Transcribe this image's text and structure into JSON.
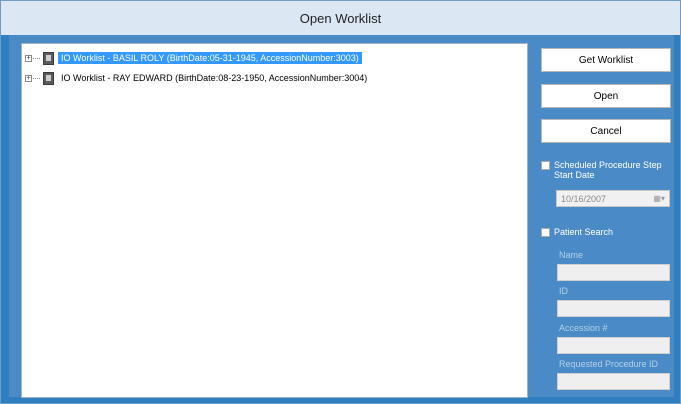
{
  "window": {
    "title": "Open Worklist"
  },
  "tree": {
    "items": [
      {
        "label": "IO Worklist - BASIL ROLY (BirthDate:05-31-1945, AccessionNumber:3003)",
        "selected": true
      },
      {
        "label": "IO Worklist - RAY EDWARD (BirthDate:08-23-1950, AccessionNumber:3004)",
        "selected": false
      }
    ]
  },
  "buttons": {
    "get_worklist": "Get Worklist",
    "open": "Open",
    "cancel": "Cancel"
  },
  "scheduled": {
    "checkbox_label": "Scheduled Procedure Step Start Date",
    "checked": false,
    "date_value": "10/16/2007"
  },
  "patient_search": {
    "checkbox_label": "Patient Search",
    "checked": false,
    "fields": {
      "name_label": "Name",
      "id_label": "ID",
      "accession_label": "Accession #",
      "requested_label": "Requested Procedure ID"
    }
  },
  "icons": {
    "expander": "plus-expander-icon",
    "document": "worklist-document-icon",
    "calendar": "calendar-dropdown-icon"
  },
  "colors": {
    "frame": "#2f7fc0",
    "selection": "#3399ff"
  }
}
